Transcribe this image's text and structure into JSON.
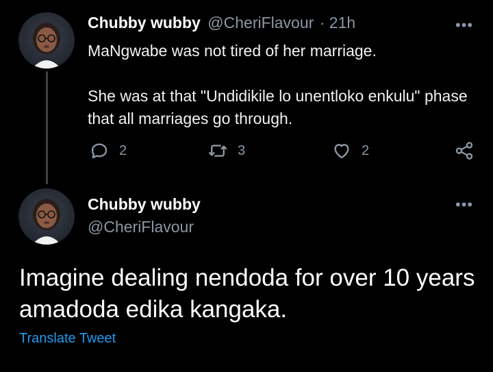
{
  "tweet1": {
    "display_name": "Chubby wubby",
    "handle": "@CheriFlavour",
    "time": "· 21h",
    "more": "•••",
    "text_p1": "MaNgwabe was not tired of her marriage.",
    "text_p2": "She was at that \"Undidikile lo unentloko enkulu\" phase that all marriages go through.",
    "reply_count": "2",
    "retweet_count": "3",
    "like_count": "2"
  },
  "tweet2": {
    "display_name": "Chubby wubby",
    "handle": "@CheriFlavour",
    "more": "•••",
    "text": "Imagine dealing nendoda for over 10 years amadoda edika kangaka.",
    "translate_label": "Translate Tweet"
  },
  "colors": {
    "background": "#000000",
    "muted": "#8b98a5",
    "link": "#1d9bf0",
    "thread_line": "#3d4147"
  }
}
